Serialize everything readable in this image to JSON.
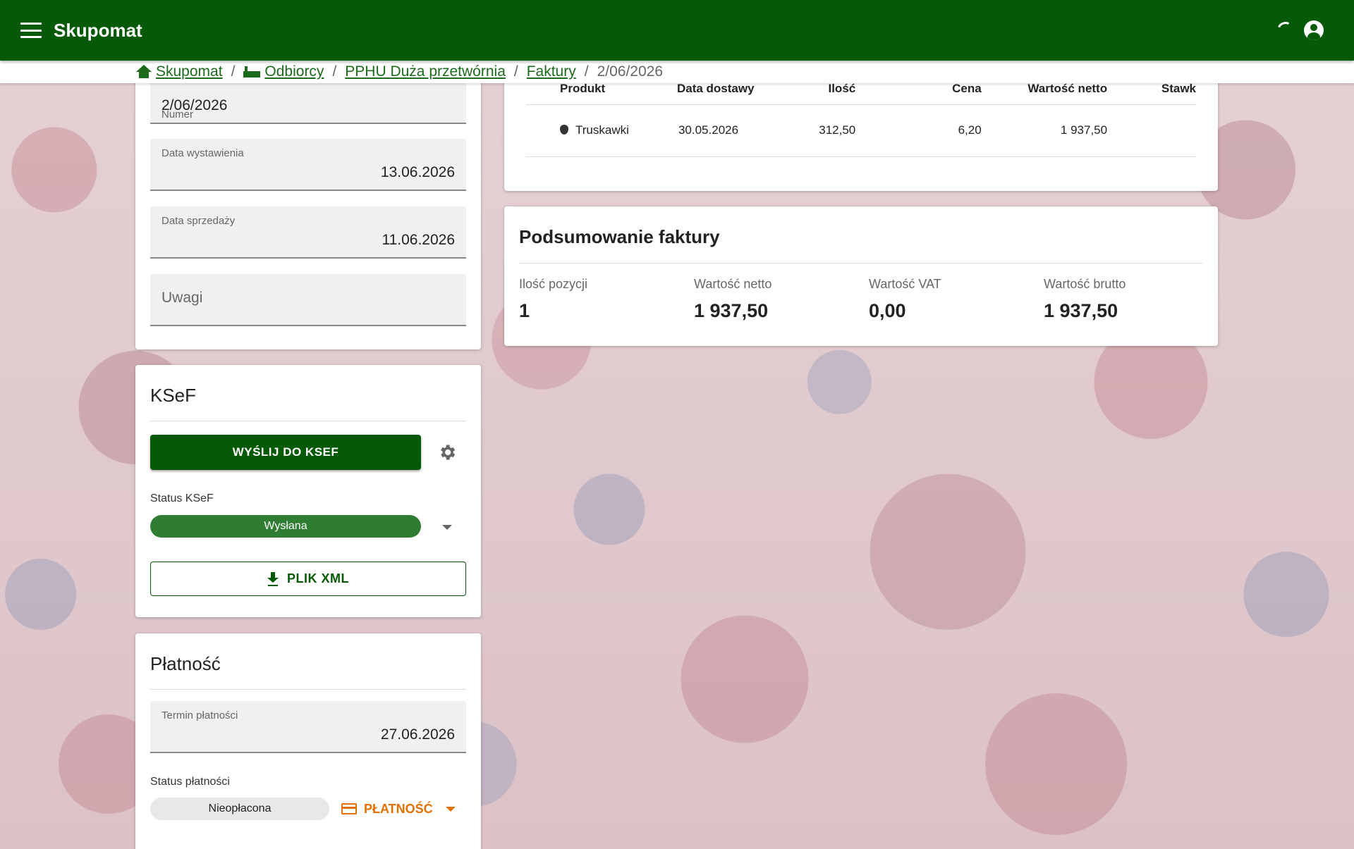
{
  "app": {
    "title": "Skupomat"
  },
  "breadcrumb": {
    "items": [
      "Skupomat",
      "Odbiorcy",
      "PPHU Duża przetwórnia",
      "Faktury"
    ],
    "current": "2/06/2026",
    "separator": "/"
  },
  "invoice": {
    "numer_label": "Numer",
    "numer_value": "2/06/2026",
    "data_wystawienia_label": "Data wystawienia",
    "data_wystawienia_value": "13.06.2026",
    "data_sprzedazy_label": "Data sprzedaży",
    "data_sprzedazy_value": "11.06.2026",
    "uwagi_placeholder": "Uwagi"
  },
  "ksef": {
    "title": "KSeF",
    "send_button": "WYŚLIJ DO KSEF",
    "status_label": "Status KSeF",
    "status_value": "Wysłana",
    "xml_button": "PLIK XML"
  },
  "payment": {
    "title": "Płatność",
    "termin_label": "Termin płatności",
    "termin_value": "27.06.2026",
    "status_label": "Status płatności",
    "status_value": "Nieopłacona",
    "payment_button": "PŁATNOŚĆ"
  },
  "items_table": {
    "headers": [
      "Produkt",
      "Data dostawy",
      "Ilość",
      "Cena",
      "Wartość netto",
      "Stawk"
    ],
    "rows": [
      {
        "produkt": "Truskawki",
        "data_dostawy": "30.05.2026",
        "ilosc": "312,50",
        "cena": "6,20",
        "wartosc_netto": "1 937,50",
        "stawka": ""
      }
    ]
  },
  "summary": {
    "title": "Podsumowanie faktury",
    "ilosc_pozycji_label": "Ilość pozycji",
    "ilosc_pozycji_value": "1",
    "wartosc_netto_label": "Wartość netto",
    "wartosc_netto_value": "1 937,50",
    "wartosc_vat_label": "Wartość VAT",
    "wartosc_vat_value": "0,00",
    "wartosc_brutto_label": "Wartość brutto",
    "wartosc_brutto_value": "1 937,50"
  },
  "colors": {
    "primary": "#065a07",
    "accent": "#e07000",
    "status_green": "#2e7d32"
  },
  "icons": [
    "menu-icon",
    "loading-icon",
    "account-icon",
    "home-icon",
    "factory-icon",
    "gear-icon",
    "download-icon",
    "credit-card-icon",
    "chevron-down-icon",
    "strawberry-icon"
  ]
}
